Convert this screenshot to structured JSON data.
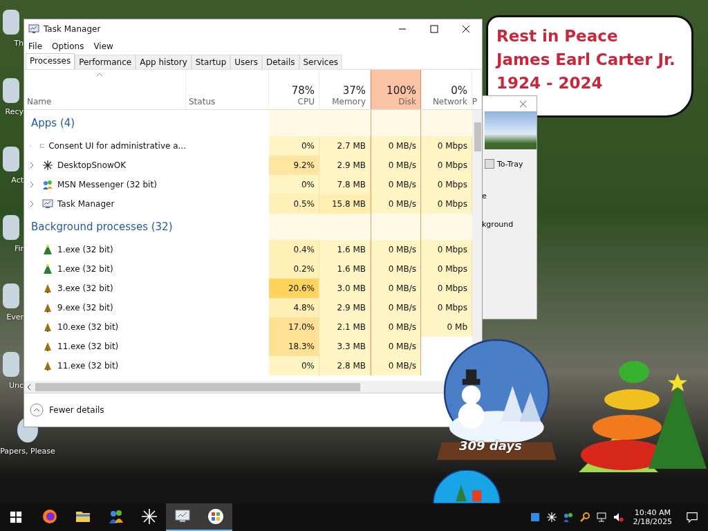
{
  "desktop_icons": [
    {
      "label": "Th"
    },
    {
      "label": "Recy"
    },
    {
      "label": "Act"
    },
    {
      "label": "Fir"
    },
    {
      "label": "Ever"
    },
    {
      "label": "Unc"
    },
    {
      "label": "Papers, Please"
    }
  ],
  "memorial_note": {
    "lines": [
      "Rest in Peace",
      "James Earl Carter Jr.",
      "1924 - 2024"
    ]
  },
  "back_window": {
    "checkbox": {
      "label": "To-Tray",
      "checked": false
    },
    "texts": [
      "e",
      "kground"
    ]
  },
  "task_manager": {
    "title": "Task Manager",
    "menu": [
      "File",
      "Options",
      "View"
    ],
    "tabs": [
      {
        "label": "Processes",
        "selected": true
      },
      {
        "label": "Performance",
        "selected": false
      },
      {
        "label": "App history",
        "selected": false
      },
      {
        "label": "Startup",
        "selected": false
      },
      {
        "label": "Users",
        "selected": false
      },
      {
        "label": "Details",
        "selected": false
      },
      {
        "label": "Services",
        "selected": false
      }
    ],
    "columns": [
      {
        "label": "Name",
        "highlighted": false
      },
      {
        "label": "Status",
        "highlighted": false
      },
      {
        "label": "CPU",
        "value": "78%",
        "highlighted": false
      },
      {
        "label": "Memory",
        "value": "37%",
        "highlighted": false
      },
      {
        "label": "Disk",
        "value": "100%",
        "highlighted": true
      },
      {
        "label": "Network",
        "value": "0%",
        "highlighted": false
      },
      {
        "label": "P",
        "highlighted": false
      }
    ],
    "groups": [
      {
        "heading": "Apps (4)",
        "rows": [
          {
            "name": "Consent UI for administrative a...",
            "kind": "window",
            "expandable": true,
            "cells": [
              {
                "text": "0%",
                "color": "#fff4c4"
              },
              {
                "text": "2.7 MB",
                "color": "#fff4c4"
              },
              {
                "text": "0 MB/s",
                "color": "#fff4c4"
              },
              {
                "text": "0 Mbps",
                "color": "#fff4c4"
              }
            ]
          },
          {
            "name": "DesktopSnowOK",
            "kind": "snowflake",
            "expandable": true,
            "cells": [
              {
                "text": "9.2%",
                "color": "#ffe6a0"
              },
              {
                "text": "2.9 MB",
                "color": "#fff4c4"
              },
              {
                "text": "0 MB/s",
                "color": "#fff4c4"
              },
              {
                "text": "0 Mbps",
                "color": "#fff4c4"
              }
            ]
          },
          {
            "name": "MSN Messenger (32 bit)",
            "kind": "people",
            "expandable": true,
            "cells": [
              {
                "text": "0%",
                "color": "#fff4c4"
              },
              {
                "text": "7.8 MB",
                "color": "#fff4c4"
              },
              {
                "text": "0 MB/s",
                "color": "#fff4c4"
              },
              {
                "text": "0 Mbps",
                "color": "#fff4c4"
              }
            ]
          },
          {
            "name": "Task Manager",
            "kind": "monitor",
            "expandable": true,
            "cells": [
              {
                "text": "0.5%",
                "color": "#fff0b8"
              },
              {
                "text": "15.8 MB",
                "color": "#ffeeb0"
              },
              {
                "text": "0 MB/s",
                "color": "#fff4c4"
              },
              {
                "text": "0 Mbps",
                "color": "#fff4c4"
              }
            ]
          }
        ]
      },
      {
        "heading": "Background processes (32)",
        "rows": [
          {
            "name": "1.exe (32 bit)",
            "kind": "tree",
            "expandable": false,
            "cells": [
              {
                "text": "0.4%",
                "color": "#fff0b8"
              },
              {
                "text": "1.6 MB",
                "color": "#fff4c4"
              },
              {
                "text": "0 MB/s",
                "color": "#fff4c4"
              },
              {
                "text": "0 Mbps",
                "color": "#fff4c4"
              }
            ]
          },
          {
            "name": "1.exe (32 bit)",
            "kind": "tree",
            "expandable": false,
            "cells": [
              {
                "text": "0.2%",
                "color": "#fff0b8"
              },
              {
                "text": "1.6 MB",
                "color": "#fff4c4"
              },
              {
                "text": "0 MB/s",
                "color": "#fff4c4"
              },
              {
                "text": "0 Mbps",
                "color": "#fff4c4"
              }
            ]
          },
          {
            "name": "3.exe (32 bit)",
            "kind": "cone",
            "expandable": false,
            "cells": [
              {
                "text": "20.6%",
                "color": "#ffd35e"
              },
              {
                "text": "3.0 MB",
                "color": "#fff4c4"
              },
              {
                "text": "0 MB/s",
                "color": "#fff4c4"
              },
              {
                "text": "0 Mbps",
                "color": "#fff4c4"
              }
            ]
          },
          {
            "name": "9.exe (32 bit)",
            "kind": "cone",
            "expandable": false,
            "cells": [
              {
                "text": "4.8%",
                "color": "#ffefb4"
              },
              {
                "text": "2.9 MB",
                "color": "#fff4c4"
              },
              {
                "text": "0 MB/s",
                "color": "#fff4c4"
              },
              {
                "text": "0 Mbps",
                "color": "#fff4c4"
              }
            ]
          },
          {
            "name": "10.exe (32 bit)",
            "kind": "cone",
            "expandable": false,
            "cells": [
              {
                "text": "17.0%",
                "color": "#ffe196"
              },
              {
                "text": "2.1 MB",
                "color": "#fff4c4"
              },
              {
                "text": "0 MB/s",
                "color": "#fff4c4"
              },
              {
                "text": "0 Mb",
                "color": "#fff4c4"
              }
            ]
          },
          {
            "name": "11.exe (32 bit)",
            "kind": "cone",
            "expandable": false,
            "cells": [
              {
                "text": "18.3%",
                "color": "#ffe196"
              },
              {
                "text": "3.3 MB",
                "color": "#fff4c4"
              },
              {
                "text": "0 MB/s",
                "color": "#fff4c4"
              }
            ]
          },
          {
            "name": "11.exe (32 bit)",
            "kind": "cone",
            "expandable": false,
            "cells": [
              {
                "text": "0%",
                "color": "#fff4c4"
              },
              {
                "text": "2.8 MB",
                "color": "#fff4c4"
              },
              {
                "text": "0 MB/s",
                "color": "#fff4c4"
              }
            ]
          }
        ]
      }
    ],
    "footer": {
      "label": "Fewer details"
    }
  },
  "snow_globe": {
    "label": "309 days"
  },
  "taskbar": {
    "apps": [
      {
        "kind": "fox",
        "selected": false
      },
      {
        "kind": "folder",
        "selected": false
      },
      {
        "kind": "people",
        "selected": false
      },
      {
        "kind": "snowflake",
        "selected": false
      },
      {
        "kind": "monitor",
        "selected": true
      },
      {
        "kind": "flag",
        "selected": true
      }
    ],
    "time": "10:40 AM",
    "date": "2/18/2025"
  }
}
